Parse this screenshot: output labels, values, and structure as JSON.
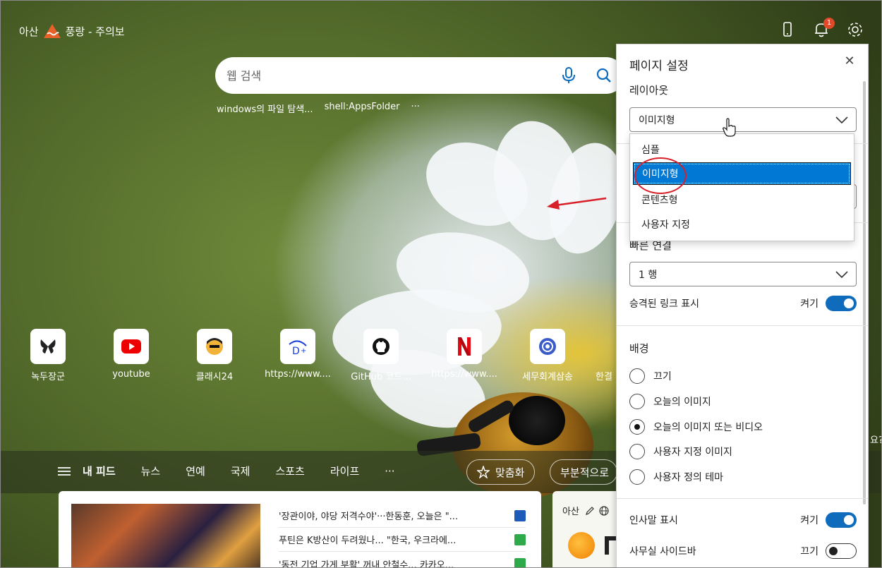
{
  "weather_top": {
    "location": "아산",
    "alert": "풍랑 - 주의보"
  },
  "notifications": {
    "count": "1"
  },
  "search": {
    "placeholder": "웹 검색",
    "recent": [
      "windows의 파일 탐색...",
      "shell:AppsFolder",
      "···"
    ]
  },
  "quick_links": [
    {
      "label": "녹두장군",
      "icon": "butterfly-icon"
    },
    {
      "label": "youtube",
      "icon": "youtube-icon"
    },
    {
      "label": "클래시24",
      "icon": "avatar-icon"
    },
    {
      "label": "https://www....",
      "icon": "disney-icon"
    },
    {
      "label": "GitHub 코드...",
      "icon": "github-icon"
    },
    {
      "label": "https://www....",
      "icon": "netflix-icon"
    },
    {
      "label": "세무회계삼송",
      "icon": "globe-icon"
    },
    {
      "label": "한결",
      "icon": "partial-icon"
    }
  ],
  "feed_nav": {
    "items": [
      "내 피드",
      "뉴스",
      "연예",
      "국제",
      "스포츠",
      "라이프",
      "···"
    ],
    "personalize": "맞춤화",
    "partial": "부분적으로"
  },
  "news": {
    "items": [
      "'장관이야, 야당 저격수야'···한동훈, 오늘은 \"...",
      "푸틴은 K방산이 두려웠나... \"한국, 우크라에...",
      "'동전 기업 가게 부활' 꺼내 안철수... 카카오..."
    ]
  },
  "weather_card": {
    "location": "아산"
  },
  "edge_hint": "요?",
  "panel": {
    "title": "페이지 설정",
    "layout_label": "레이아웃",
    "layout_value": "이미지형",
    "layout_options": [
      "심플",
      "이미지형",
      "콘텐츠형",
      "사용자 지정"
    ],
    "quick_links_label": "빠른 연결",
    "quick_links_value": "1 행",
    "promoted_links": {
      "label": "승격된 링크 표시",
      "state": "켜기"
    },
    "background_label": "배경",
    "background_options": [
      "끄기",
      "오늘의 이미지",
      "오늘의 이미지 또는 비디오",
      "사용자 지정 이미지",
      "사용자 정의 테마"
    ],
    "background_selected": 2,
    "greeting": {
      "label": "인사말 표시",
      "state": "켜기"
    },
    "office_sidebar": {
      "label": "사무실 사이드바",
      "state": "끄기"
    }
  },
  "colors": {
    "accent": "#0f6cbd",
    "selection": "#0078d4",
    "annotation": "#d8202a"
  }
}
